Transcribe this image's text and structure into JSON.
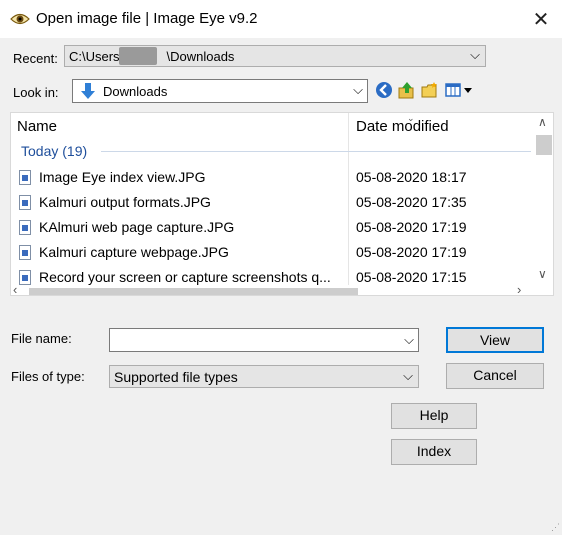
{
  "window": {
    "title": "Open image file | Image Eye v9.2",
    "close_glyph": "✕"
  },
  "recent": {
    "label": "Recent:",
    "value": "C:\\Users\\r   \\Downloads"
  },
  "look_in": {
    "label": "Look in:",
    "value": "Downloads"
  },
  "toolbar_icons": [
    "back-icon",
    "up-folder-icon",
    "new-folder-icon",
    "view-menu-icon"
  ],
  "file_list": {
    "columns": [
      "Name",
      "Date modified"
    ],
    "group": "Today (19)",
    "rows": [
      {
        "name": "Image Eye index view.JPG",
        "date": "05-08-2020 18:17"
      },
      {
        "name": "Kalmuri output formats.JPG",
        "date": "05-08-2020 17:35"
      },
      {
        "name": "KAlmuri web page capture.JPG",
        "date": "05-08-2020 17:19"
      },
      {
        "name": "Kalmuri capture webpage.JPG",
        "date": "05-08-2020 17:19"
      },
      {
        "name": "Record your screen or capture screenshots q...",
        "date": "05-08-2020 17:15"
      }
    ]
  },
  "file_name": {
    "label": "File name:",
    "value": ""
  },
  "files_of_type": {
    "label": "Files of type:",
    "value": "Supported file types"
  },
  "buttons": {
    "view": "View",
    "cancel": "Cancel",
    "help": "Help",
    "index": "Index"
  },
  "colors": {
    "group_text": "#1e4e9b",
    "focus_border": "#0078d7"
  }
}
